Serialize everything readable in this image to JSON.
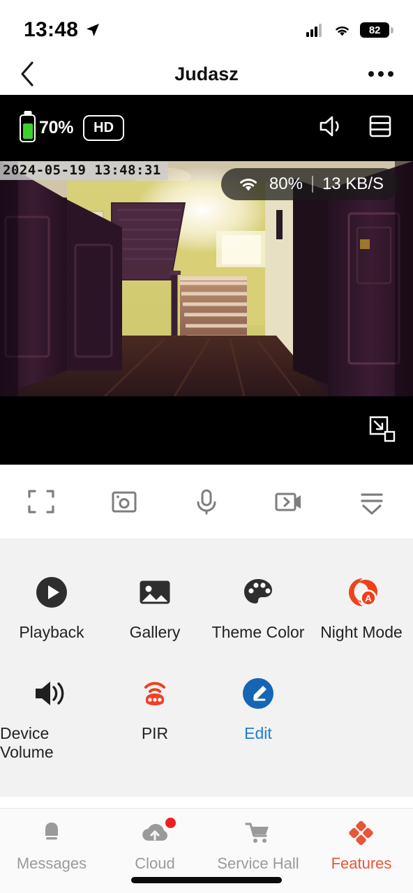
{
  "status_bar": {
    "time": "13:48",
    "location_icon": "location-arrow-icon",
    "signal_icon": "cellular-signal-icon",
    "wifi_icon": "wifi-icon",
    "battery_percent": "82"
  },
  "nav": {
    "back_icon": "chevron-left-icon",
    "title": "Judasz",
    "more_icon": "ellipsis-icon"
  },
  "video": {
    "device_battery": "70%",
    "quality_badge": "HD",
    "speaker_icon": "speaker-on-icon",
    "layout_icon": "split-view-icon",
    "timestamp": "2024-05-19  13:48:31",
    "wifi_icon": "wifi-icon",
    "wifi_strength": "80%",
    "bitrate": "13 KB/S",
    "pip_icon": "picture-in-picture-icon"
  },
  "controls": [
    {
      "name": "fullscreen",
      "icon": "fullscreen-icon"
    },
    {
      "name": "snapshot",
      "icon": "snapshot-icon"
    },
    {
      "name": "talk",
      "icon": "microphone-icon"
    },
    {
      "name": "record",
      "icon": "record-video-icon"
    },
    {
      "name": "more",
      "icon": "expand-more-icon"
    }
  ],
  "features": {
    "row1": [
      {
        "label": "Playback",
        "icon": "play-circle-icon"
      },
      {
        "label": "Gallery",
        "icon": "image-icon"
      },
      {
        "label": "Theme Color",
        "icon": "palette-icon"
      },
      {
        "label": "Night Mode",
        "icon": "night-mode-auto-icon"
      }
    ],
    "row2": [
      {
        "label": "Device Volume",
        "icon": "volume-icon"
      },
      {
        "label": "PIR",
        "icon": "pir-sensor-icon"
      },
      {
        "label": "Edit",
        "icon": "edit-pencil-icon"
      }
    ]
  },
  "tabs": [
    {
      "label": "Messages",
      "icon": "bell-icon",
      "active": false,
      "badge": false
    },
    {
      "label": "Cloud",
      "icon": "cloud-upload-icon",
      "active": false,
      "badge": true
    },
    {
      "label": "Service Hall",
      "icon": "shopping-cart-icon",
      "active": false,
      "badge": false
    },
    {
      "label": "Features",
      "icon": "diamonds-icon",
      "active": true,
      "badge": false
    }
  ],
  "colors": {
    "accent": "#e8553a",
    "edit_blue": "#1565b5",
    "battery_green": "#3cd02e",
    "badge_red": "#f01f1f"
  }
}
